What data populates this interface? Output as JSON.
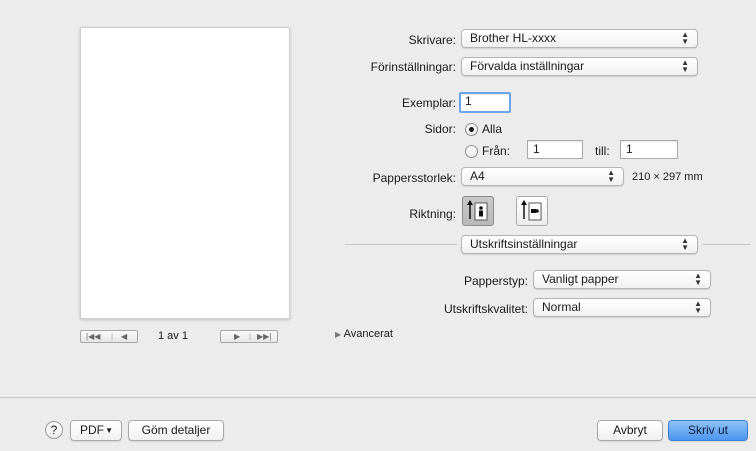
{
  "printer": {
    "label": "Skrivare:",
    "value": "Brother HL-xxxx"
  },
  "presets": {
    "label": "Förinställningar:",
    "value": "Förvalda inställningar"
  },
  "copies": {
    "label": "Exemplar:",
    "value": "1"
  },
  "pages": {
    "label": "Sidor:",
    "all_label": "Alla",
    "from_label": "Från:",
    "from_value": "1",
    "to_label": "till:",
    "to_value": "1",
    "selected": "all"
  },
  "paper_size": {
    "label": "Pappersstorlek:",
    "value": "A4",
    "dimensions": "210 × 297 mm"
  },
  "orientation": {
    "label": "Riktning:",
    "selected": "portrait"
  },
  "section": {
    "value": "Utskriftsinställningar"
  },
  "paper_type": {
    "label": "Papperstyp:",
    "value": "Vanligt papper"
  },
  "print_quality": {
    "label": "Utskriftskvalitet:",
    "value": "Normal"
  },
  "advanced": {
    "label": "Avancerat"
  },
  "pager": {
    "text": "1 av 1"
  },
  "footer": {
    "help": "?",
    "pdf_label": "PDF",
    "hide_details": "Göm detaljer",
    "cancel": "Avbryt",
    "print": "Skriv ut"
  },
  "icons": {
    "popup_arrows": "up-down-chevrons-icon",
    "pdf_menu": "down-triangle-icon",
    "disclosure": "right-triangle-icon"
  },
  "colors": {
    "window_bg": "#ececec",
    "default_button": "#4d96ee",
    "focus_ring": "#6aa5e8"
  }
}
